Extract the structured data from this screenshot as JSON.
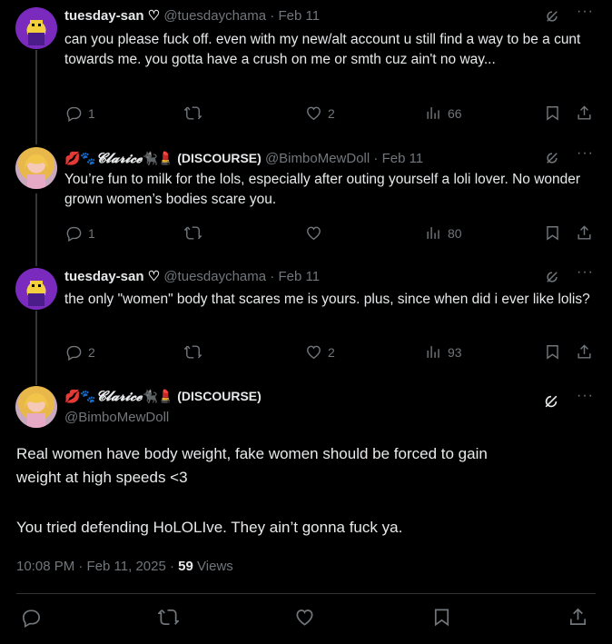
{
  "tweets": [
    {
      "display_name": "tuesday-san ♡",
      "handle": "@tuesdaychama",
      "date": "Feb 11",
      "text": "can you please fuck off. even with my new/alt account u still find a way to be a cunt towards me. you gotta have a crush on me or smth cuz ain't no way...",
      "replies": "1",
      "reposts": "",
      "likes": "2",
      "views": "66"
    },
    {
      "display_name_prefix": "💋🐾",
      "display_name_fancy": "𝓒𝓵𝓪𝓻𝓲𝓬𝓮",
      "display_name_suffix": "🐈‍⬛💄 (DISCOURSE)",
      "handle": "@BimboMewDoll",
      "date": "Feb 11",
      "text": "You’re fun to milk for the lols, especially after outing yourself a loli lover.  No wonder grown women’s bodies scare you.",
      "replies": "1",
      "reposts": "",
      "likes": "",
      "views": "80"
    },
    {
      "display_name": "tuesday-san ♡",
      "handle": "@tuesdaychama",
      "date": "Feb 11",
      "text": "the only \"women\" body that scares me is yours. plus, since when did i ever like lolis?",
      "replies": "2",
      "reposts": "",
      "likes": "2",
      "views": "93"
    }
  ],
  "main_tweet": {
    "display_name_prefix": "💋🐾",
    "display_name_fancy": "𝓒𝓵𝓪𝓻𝓲𝓬𝓮",
    "display_name_suffix": "🐈‍⬛💄 (DISCOURSE)",
    "handle": "@BimboMewDoll",
    "text_line1": "Real women have body weight, fake women should be forced to gain",
    "text_line2": "weight at high speeds <3",
    "text_line3": "You tried defending HoLOLIve.  They ain’t gonna fuck ya.",
    "time": "10:08 PM · Feb 11, 2025 ·",
    "views_count": "59",
    "views_label": "Views"
  },
  "icons": {
    "reply": "reply-icon",
    "repost": "repost-icon",
    "like": "like-icon",
    "views": "views-icon",
    "bookmark": "bookmark-icon",
    "share": "share-icon",
    "grok": "grok-icon",
    "more": "more-icon"
  },
  "colors": {
    "background": "#000000",
    "text": "#e7e9ea",
    "muted": "#71767b",
    "divider": "#2f3336"
  }
}
